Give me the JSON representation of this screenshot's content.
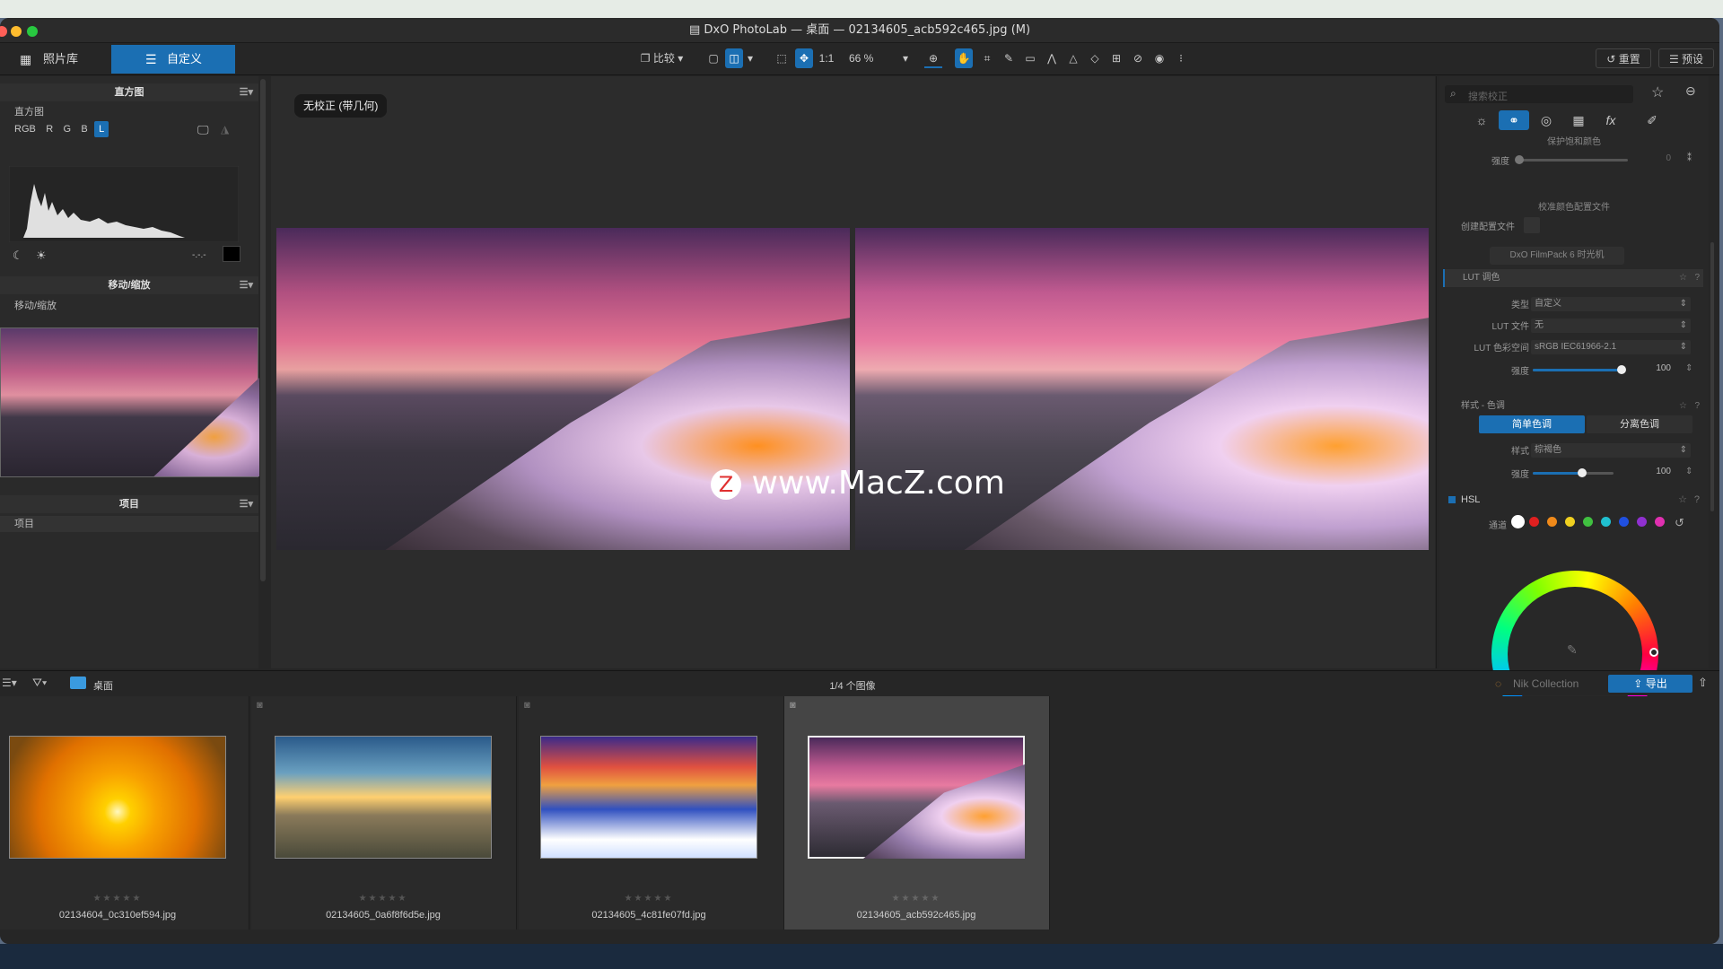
{
  "window": {
    "title": "DxO PhotoLab — 桌面 — 02134605_acb592c465.jpg (M)"
  },
  "toolbar": {
    "tab_library": "照片库",
    "tab_customize": "自定义",
    "compare": "比较",
    "one_to_one": "1:1",
    "zoom": "66 %",
    "reset": "重置",
    "preset": "预设"
  },
  "left": {
    "histogram": {
      "header": "直方图",
      "label": "直方图",
      "channels": [
        "RGB",
        "R",
        "G",
        "B",
        "L"
      ],
      "active_channel": "L",
      "value": "-.-.-"
    },
    "move_zoom": {
      "header": "移动/缩放",
      "label": "移动/缩放"
    },
    "projects": {
      "header": "项目",
      "label": "项目"
    }
  },
  "viewer": {
    "badge": "无校正 (带几何)",
    "watermark": "www.MacZ.com"
  },
  "right": {
    "search_placeholder": "搜索校正",
    "protect_sat": "保护饱和颜色",
    "strength": "强度",
    "strength_value": "0",
    "calib_profile": "校准颜色配置文件",
    "create_profile": "创建配置文件",
    "filmpack": "DxO FilmPack 6 时光机",
    "lut": {
      "header": "LUT 调色",
      "type_label": "类型",
      "type_value": "自定义",
      "file_label": "LUT 文件",
      "file_value": "无",
      "space_label": "LUT 色彩空间",
      "space_value": "sRGB IEC61966-2.1",
      "strength_label": "强度",
      "strength_value": "100",
      "strength_level": 100
    },
    "style": {
      "header": "样式 - 色调",
      "simple": "简单色调",
      "split": "分离色调",
      "style_label": "样式",
      "style_value": "棕褐色",
      "strength_label": "强度",
      "strength_value": "100",
      "strength_level": 100
    },
    "hsl": {
      "header": "HSL",
      "channel_label": "通道",
      "channels": [
        "#ffffff",
        "#e02020",
        "#f08a1a",
        "#f0d020",
        "#40c040",
        "#20c0d0",
        "#2050e0",
        "#9030d0",
        "#e030b0"
      ]
    }
  },
  "bottom": {
    "folder": "桌面",
    "count": "1/4 个图像",
    "nik": "Nik Collection",
    "export": "导出",
    "thumbs": [
      {
        "name": "02134604_0c310ef594.jpg",
        "stars": "★★★★★"
      },
      {
        "name": "02134605_0a6f8f6d5e.jpg",
        "stars": "★★★★★"
      },
      {
        "name": "02134605_4c81fe07fd.jpg",
        "stars": "★★★★★"
      },
      {
        "name": "02134605_acb592c465.jpg",
        "stars": "★★★★★"
      }
    ]
  }
}
